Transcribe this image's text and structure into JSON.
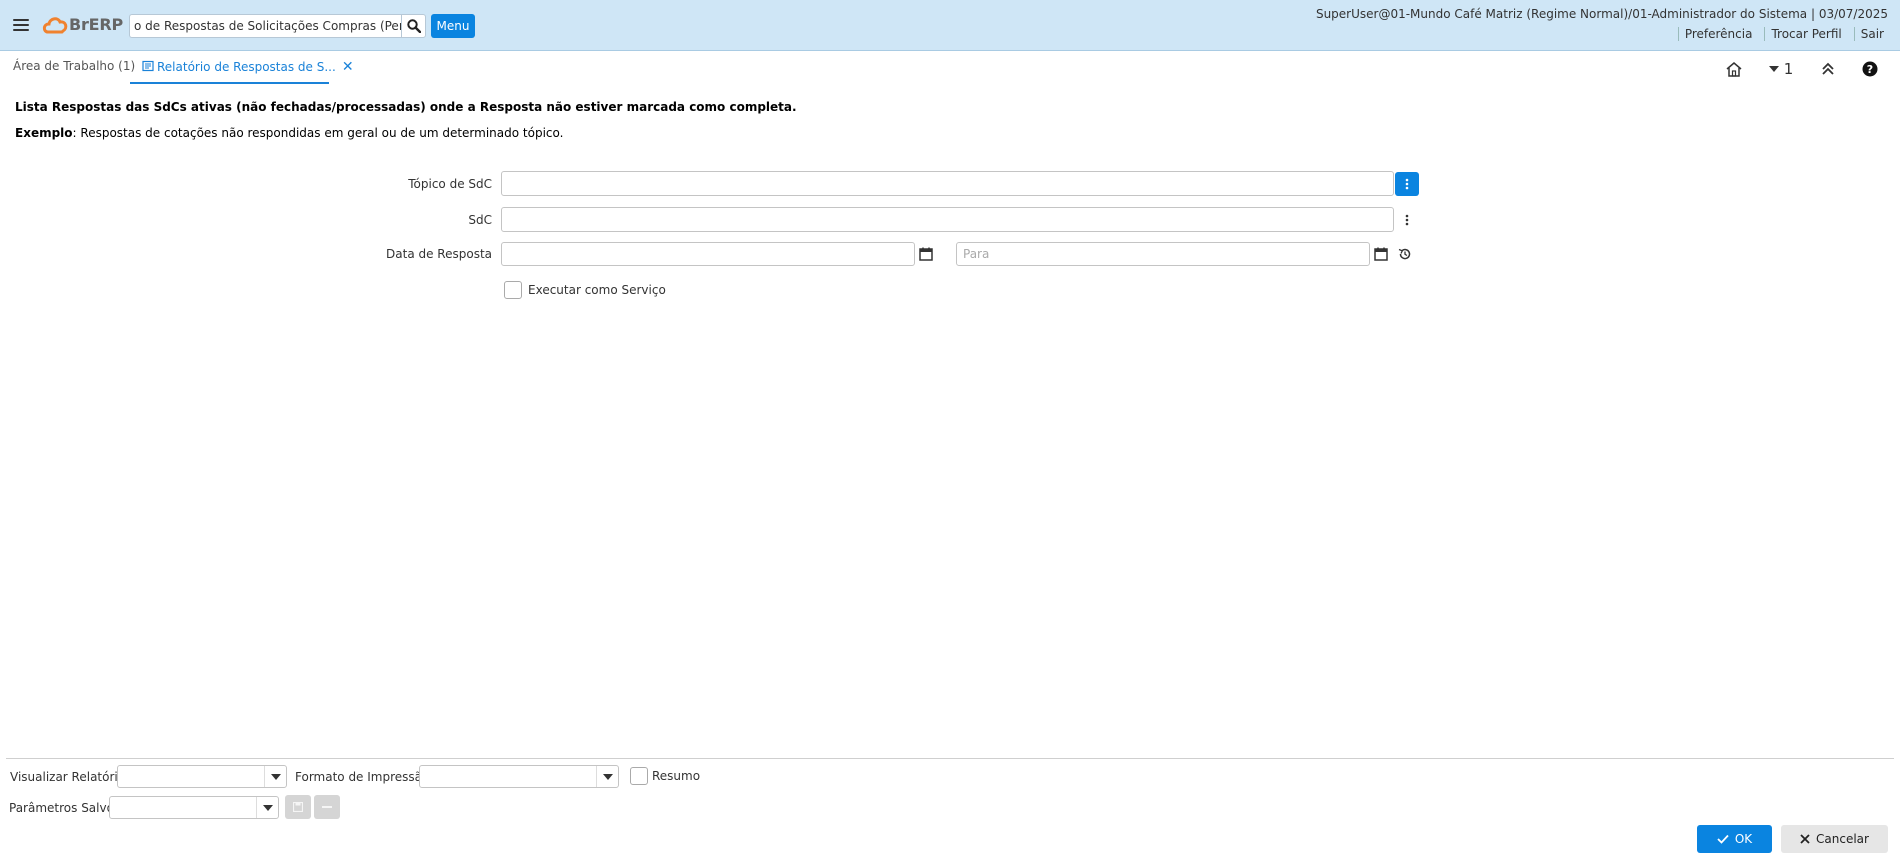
{
  "header": {
    "logo_text": "BrERP",
    "search_value": "o de Respostas de Solicitações Compras (Pendente)",
    "menu_label": "Menu",
    "user_info": "SuperUser@01-Mundo Café Matriz (Regime Normal)/01-Administrador do Sistema | 03/07/2025",
    "links": [
      "Preferência",
      "Trocar Perfil",
      "Sair"
    ]
  },
  "tabs": [
    {
      "label": "Área de Trabalho (1)"
    },
    {
      "label": "Relatório de Respostas de S..."
    }
  ],
  "toolbar": {
    "window_count": "1"
  },
  "description": {
    "line1": "Lista Respostas das SdCs ativas (não fechadas/processadas) onde a Resposta não estiver marcada como completa.",
    "example_bold": "Exemplo",
    "example_text": ": Respostas de cotações não respondidas em geral ou de um determinado tópico."
  },
  "form": {
    "topic_label": "Tópico de SdC",
    "topic_value": "",
    "rfq_label": "SdC",
    "rfq_value": "",
    "date_label": "Data de Resposta",
    "date_from_value": "",
    "date_to_placeholder": "Para",
    "run_as_service_label": "Executar como Serviço"
  },
  "footer": {
    "view_report_label": "Visualizar Relatório",
    "print_format_label": "Formato de Impressão",
    "summary_label": "Resumo",
    "saved_params_label": "Parâmetros Salvos",
    "ok_label": "OK",
    "cancel_label": "Cancelar"
  },
  "colors": {
    "header_bg": "#cfe6f6",
    "accent": "#0a84e0",
    "logo_orange": "#f0822f"
  }
}
